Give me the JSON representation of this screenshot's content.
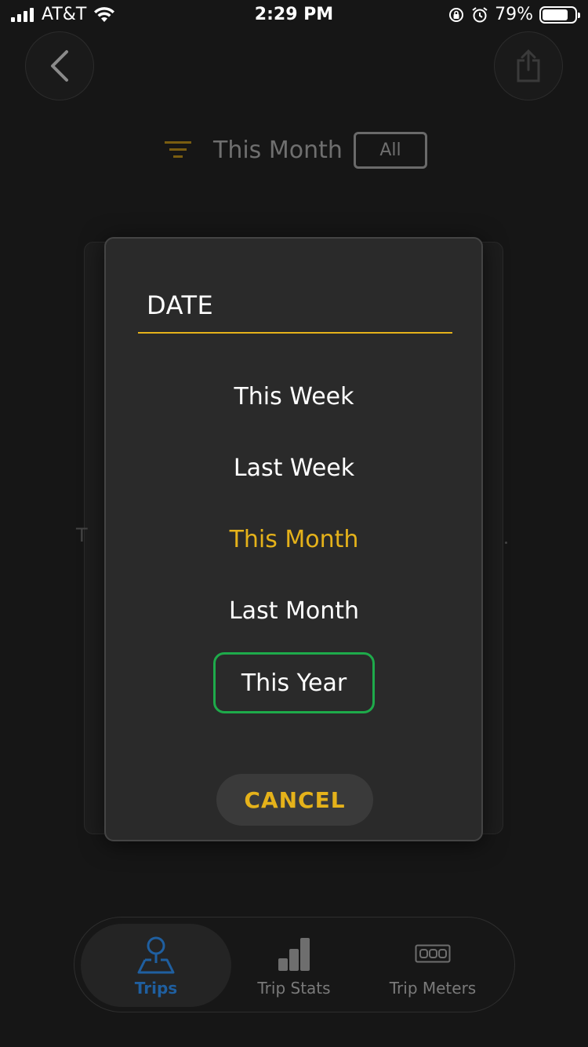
{
  "status_bar": {
    "carrier": "AT&T",
    "time": "2:29 PM",
    "battery_percent": "79%",
    "icons": [
      "signal-icon",
      "wifi-icon",
      "rotation-lock-icon",
      "alarm-icon",
      "battery-icon"
    ]
  },
  "header": {
    "back_icon": "chevron-left-icon",
    "share_icon": "share-icon"
  },
  "filter": {
    "icon": "filter-icon",
    "label": "This Month",
    "chip": "All"
  },
  "modal": {
    "title": "DATE",
    "options": [
      {
        "label": "This Week",
        "state": "normal"
      },
      {
        "label": "Last Week",
        "state": "normal"
      },
      {
        "label": "This Month",
        "state": "selected"
      },
      {
        "label": "Last Month",
        "state": "normal"
      },
      {
        "label": "This Year",
        "state": "focused"
      }
    ],
    "cancel_label": "CANCEL"
  },
  "background": {
    "partial_text": "T"
  },
  "bottom_nav": {
    "items": [
      {
        "label": "Trips",
        "icon": "map-pin-icon",
        "active": true
      },
      {
        "label": "Trip Stats",
        "icon": "bar-chart-icon",
        "active": false
      },
      {
        "label": "Trip Meters",
        "icon": "odometer-icon",
        "active": false
      }
    ]
  },
  "colors": {
    "accent": "#e5b21a",
    "focus_outline": "#1eaa4a",
    "active_nav": "#1f5fa0",
    "background": "#161616",
    "modal": "#2a2a2a"
  }
}
